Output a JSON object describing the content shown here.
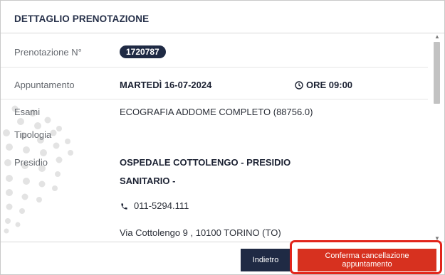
{
  "dialog": {
    "title": "DETTAGLIO PRENOTAZIONE"
  },
  "details": {
    "booking_label": "Prenotazione N°",
    "booking_number": "1720787",
    "appointment_label": "Appuntamento",
    "appointment_date": "MARTEDÌ 16-07-2024",
    "appointment_time": "ORE 09:00",
    "exams_label": "Esami",
    "exams_value": "ECOGRAFIA ADDOME COMPLETO (88756.0)",
    "type_label": "Tipologia",
    "facility_label": "Presidio",
    "facility_name_line1": "OSPEDALE COTTOLENGO - PRESIDIO",
    "facility_name_line2": "SANITARIO -",
    "facility_phone": "011-5294.111",
    "facility_address": "Via Cottolengo 9 , 10100 TORINO (TO)"
  },
  "footer": {
    "back_label": "Indietro",
    "confirm_label": "Conferma cancellazione appuntamento"
  },
  "colors": {
    "navy": "#1f2a44",
    "danger": "#d7311f",
    "highlight": "#e2251b"
  },
  "icons": {
    "time": "clock-icon",
    "phone": "phone-icon"
  }
}
